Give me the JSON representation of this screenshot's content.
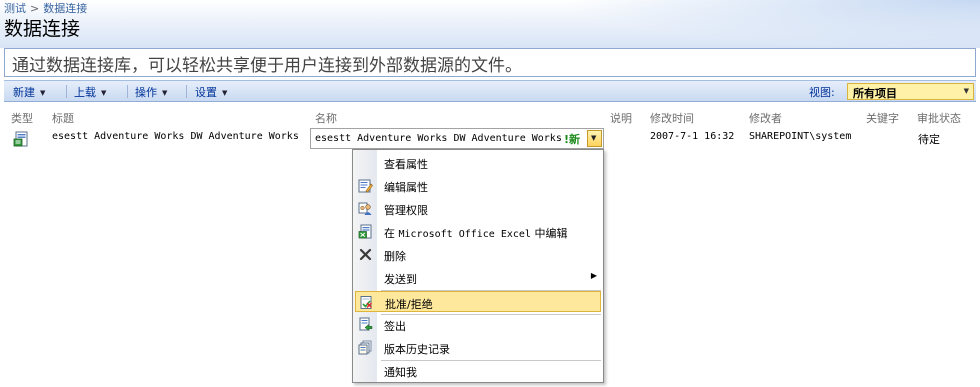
{
  "breadcrumb": {
    "root": "测试",
    "separator": ">",
    "current": "数据连接"
  },
  "page_title": "数据连接",
  "description": "通过数据连接库，可以轻松共享便于用户连接到外部数据源的文件。",
  "toolbar": {
    "new_label": "新建",
    "upload_label": "上载",
    "actions_label": "操作",
    "settings_label": "设置",
    "view_label": "视图:",
    "view_value": "所有项目"
  },
  "columns": [
    "类型",
    "标题",
    "名称",
    "说明",
    "修改时间",
    "修改者",
    "关键字",
    "审批状态"
  ],
  "row": {
    "title": "esestt Adventure Works DW Adventure Works",
    "name": "esestt Adventure Works DW Adventure Works",
    "new_badge": "!新",
    "modified": "2007-7-1 16:32",
    "modified_by": "SHAREPOINT\\system",
    "approval": "待定"
  },
  "menu": {
    "items": [
      {
        "label": "查看属性",
        "icon": "none"
      },
      {
        "label": "编辑属性",
        "icon": "edit-properties-icon"
      },
      {
        "label": "管理权限",
        "icon": "manage-permissions-icon"
      },
      {
        "label_prefix": "在",
        "label_app": "Microsoft Office Excel",
        "label_suffix": "中编辑",
        "icon": "excel-icon"
      },
      {
        "label": "删除",
        "icon": "delete-icon"
      },
      {
        "label": "发送到",
        "icon": "none",
        "submenu": true
      },
      {
        "label": "批准/拒绝",
        "icon": "approve-reject-icon",
        "highlighted": true
      },
      {
        "label": "签出",
        "icon": "check-out-icon"
      },
      {
        "label": "版本历史记录",
        "icon": "version-history-icon"
      },
      {
        "label": "通知我",
        "icon": "none"
      }
    ]
  },
  "colors": {
    "link": "#3764a0",
    "toolbar_text": "#003399",
    "highlight": "#fde89c",
    "new_badge": "#1b8a1b"
  }
}
